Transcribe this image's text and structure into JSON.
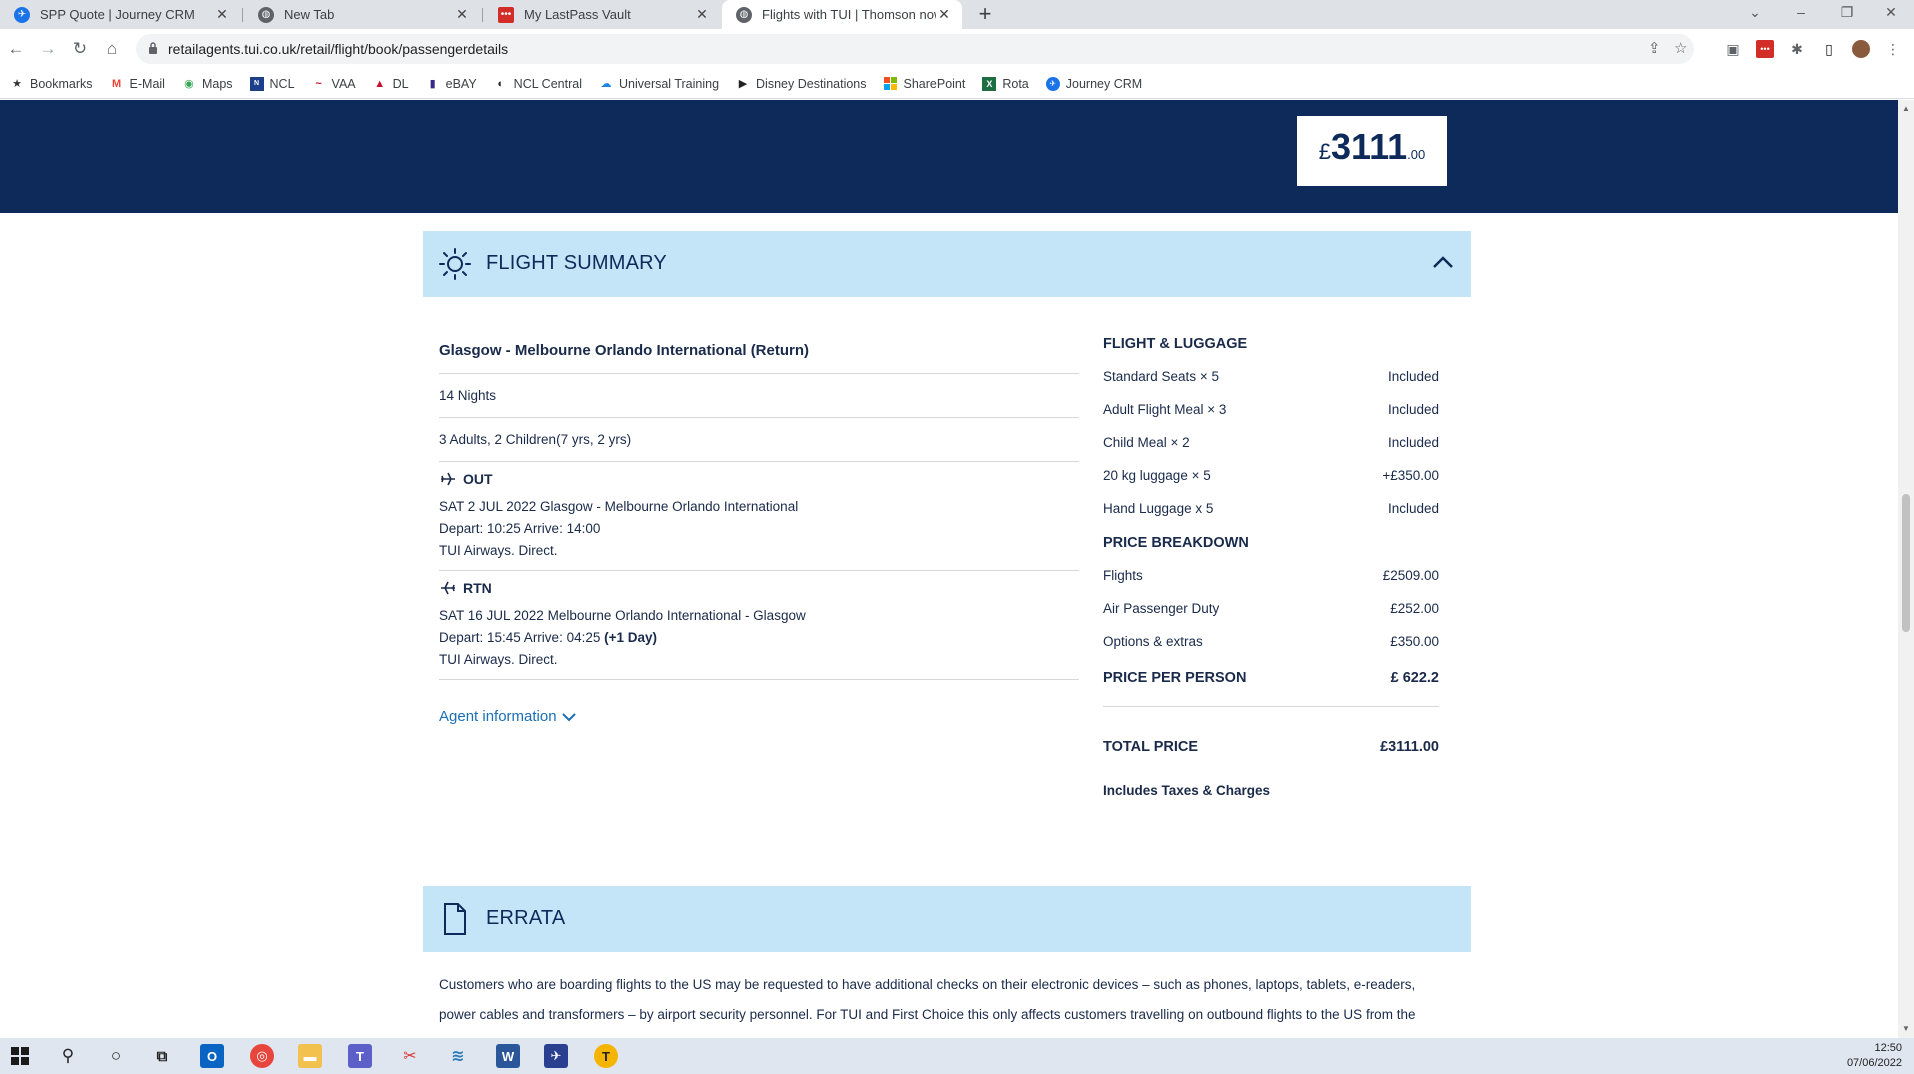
{
  "browser": {
    "tabs": [
      {
        "label": "SPP Quote | Journey CRM",
        "icon": "journey-crm-icon",
        "color": "#1a73e8"
      },
      {
        "label": "New Tab",
        "icon": "globe-icon",
        "color": "#5f6368"
      },
      {
        "label": "My LastPass Vault",
        "icon": "lastpass-icon",
        "color": "#d32d27"
      },
      {
        "label": "Flights with TUI | Thomson now T",
        "icon": "globe-icon",
        "color": "#5f6368"
      }
    ],
    "url": "retailagents.tui.co.uk/retail/flight/book/passengerdetails",
    "bookmarks": [
      {
        "label": "Bookmarks",
        "icon": "star-icon"
      },
      {
        "label": "E-Mail",
        "icon": "gmail-icon"
      },
      {
        "label": "Maps",
        "icon": "maps-pin-icon"
      },
      {
        "label": "NCL",
        "icon": "ncl-icon"
      },
      {
        "label": "VAA",
        "icon": "vaa-icon"
      },
      {
        "label": "DL",
        "icon": "delta-icon"
      },
      {
        "label": "eBAY",
        "icon": "bag-icon"
      },
      {
        "label": "NCL Central",
        "icon": "ncl-central-icon"
      },
      {
        "label": "Universal Training",
        "icon": "cloud-icon"
      },
      {
        "label": "Disney Destinations",
        "icon": "play-circle-icon"
      },
      {
        "label": "SharePoint",
        "icon": "windows-grid-icon"
      },
      {
        "label": "Rota",
        "icon": "excel-icon"
      },
      {
        "label": "Journey CRM",
        "icon": "journey-crm-icon"
      }
    ]
  },
  "banner": {
    "price_currency": "£",
    "price_amount": "3111",
    "price_pence": ".00"
  },
  "flight_summary": {
    "title": "FLIGHT SUMMARY",
    "route": "Glasgow - Melbourne Orlando International (Return)",
    "nights": "14 Nights",
    "passengers": "3  Adults, 2  Children(7  yrs, 2  yrs)",
    "outbound": {
      "label": "OUT",
      "date_route": "SAT 2 JUL 2022 Glasgow  - Melbourne Orlando International",
      "times": "Depart: 10:25 Arrive: 14:00",
      "airline": "TUI Airways. Direct."
    },
    "return": {
      "label": "RTN",
      "date_route": "SAT 16 JUL 2022 Melbourne Orlando International - Glasgow",
      "times": "Depart: 15:45 Arrive: 04:25",
      "day_offset": "(+1 Day)",
      "airline": "TUI Airways. Direct."
    },
    "agent_info_label": "Agent information"
  },
  "flight_luggage": {
    "title": "FLIGHT & LUGGAGE",
    "items": [
      {
        "label": "Standard Seats × 5",
        "value": "Included"
      },
      {
        "label": "Adult Flight Meal × 3",
        "value": "Included"
      },
      {
        "label": "Child Meal × 2",
        "value": "Included"
      },
      {
        "label": "20 kg luggage × 5",
        "value": "+£350.00"
      },
      {
        "label": "Hand Luggage x 5",
        "value": "Included"
      }
    ]
  },
  "price_breakdown": {
    "title": "PRICE BREAKDOWN",
    "items": [
      {
        "label": "Flights",
        "value": "£2509.00"
      },
      {
        "label": "Air Passenger Duty",
        "value": "£252.00"
      },
      {
        "label": "Options & extras",
        "value": "£350.00"
      }
    ],
    "per_person_label": "PRICE PER PERSON",
    "per_person_value": "£ 622.2",
    "total_label": "TOTAL PRICE",
    "total_value": "£3111.00",
    "includes_note": "Includes Taxes & Charges"
  },
  "errata": {
    "title": "ERRATA",
    "text_line1": "Customers who are boarding flights to the US may be requested to have additional checks on their electronic devices – such as phones, laptops, tablets, e-readers,",
    "text_line2": "power cables and transformers – by airport security personnel. For TUI and First Choice this only affects customers travelling on outbound flights to the US from the"
  },
  "taskbar": {
    "time": "12:50",
    "date": "07/06/2022"
  },
  "colors": {
    "banner_navy": "#0d2a5a",
    "panel_light_blue": "#c3e5f7",
    "link_blue": "#1a6fb8"
  }
}
